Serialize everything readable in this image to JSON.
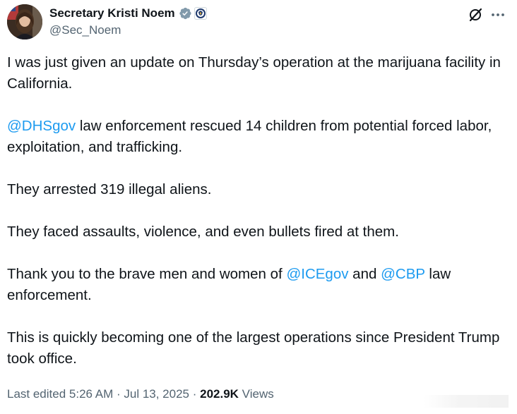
{
  "author": {
    "display_name": "Secretary Kristi Noem",
    "handle": "@Sec_Noem",
    "verified_badge_color": "#829aab",
    "avatar_icon": "profile-photo"
  },
  "header": {
    "grok_icon": "grok-icon",
    "more_icon": "more-dots-icon"
  },
  "tweet": {
    "p1": "I was just given an update on Thursday’s operation at the marijuana facility in California.",
    "p2_mention": "@DHSgov",
    "p2_text": " law enforcement rescued 14 children from potential forced labor, exploitation, and trafficking.",
    "p3": "They arrested 319 illegal aliens.",
    "p4": "They faced assaults, violence, and even bullets fired at them.",
    "p5_pre": "Thank you to the brave men and women of ",
    "p5_mention1": "@ICEgov",
    "p5_mid": " and ",
    "p5_mention2": "@CBP",
    "p5_post": " law enforcement.",
    "p6": "This is quickly becoming one of the largest operations since President Trump took office."
  },
  "meta": {
    "edited": "Last edited 5:26 AM · Jul 13, 2025 · ",
    "views_count": "202.9K",
    "views_label": " Views"
  },
  "colors": {
    "text": "#0f1419",
    "secondary": "#536471",
    "link": "#1d9bf0"
  }
}
